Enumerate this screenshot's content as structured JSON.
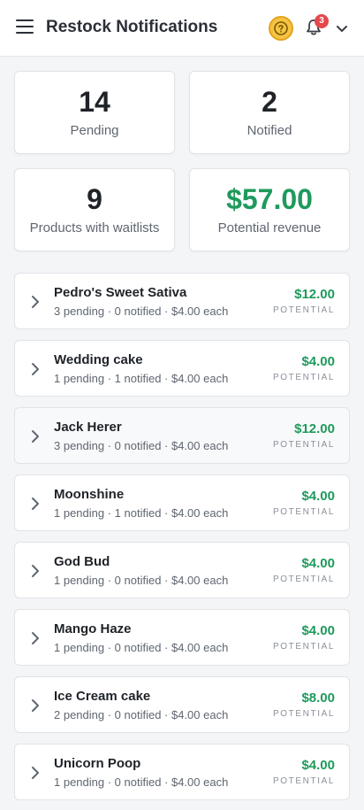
{
  "header": {
    "title": "Restock Notifications",
    "notification_count": "3",
    "help_icon": "question-circle-icon",
    "bell_icon": "bell-icon",
    "accent_color": "#f6c344"
  },
  "stats": [
    {
      "value": "14",
      "label": "Pending"
    },
    {
      "value": "2",
      "label": "Notified"
    },
    {
      "value": "9",
      "label": "Products with waitlists"
    },
    {
      "value": "$57.00",
      "label": "Potential revenue"
    }
  ],
  "products": [
    {
      "name": "Pedro's Sweet Sativa",
      "meta": "3 pending · 0 notified · $4.00 each",
      "amount": "$12.00",
      "tag": "POTENTIAL"
    },
    {
      "name": "Wedding cake",
      "meta": "1 pending · 1 notified · $4.00 each",
      "amount": "$4.00",
      "tag": "POTENTIAL"
    },
    {
      "name": "Jack Herer",
      "meta": "3 pending · 0 notified · $4.00 each",
      "amount": "$12.00",
      "tag": "POTENTIAL"
    },
    {
      "name": "Moonshine",
      "meta": "1 pending · 1 notified · $4.00 each",
      "amount": "$4.00",
      "tag": "POTENTIAL"
    },
    {
      "name": "God Bud",
      "meta": "1 pending · 0 notified · $4.00 each",
      "amount": "$4.00",
      "tag": "POTENTIAL"
    },
    {
      "name": "Mango Haze",
      "meta": "1 pending · 0 notified · $4.00 each",
      "amount": "$4.00",
      "tag": "POTENTIAL"
    },
    {
      "name": "Ice Cream cake",
      "meta": "2 pending · 0 notified · $4.00 each",
      "amount": "$8.00",
      "tag": "POTENTIAL"
    },
    {
      "name": "Unicorn Poop",
      "meta": "1 pending · 0 notified · $4.00 each",
      "amount": "$4.00",
      "tag": "POTENTIAL"
    }
  ]
}
